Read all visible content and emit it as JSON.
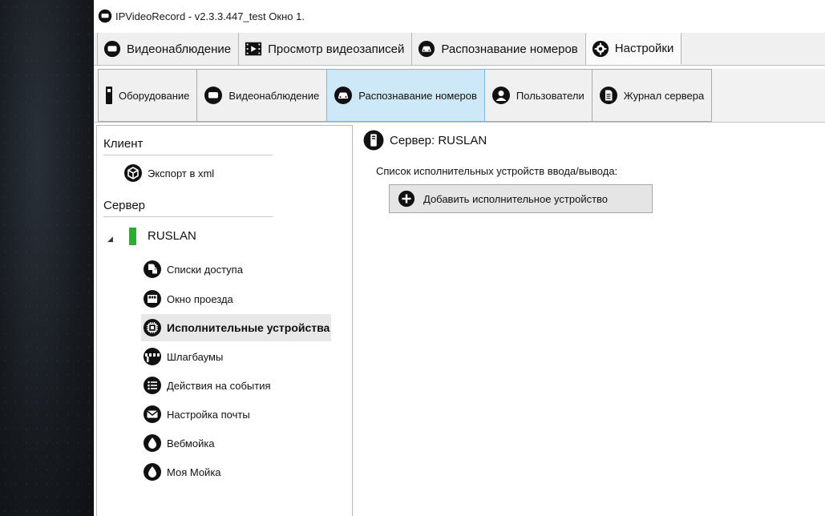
{
  "window": {
    "title": "IPVideoRecord - v2.3.3.447_test Окно 1."
  },
  "main_tabs": [
    {
      "label": "Видеонаблюдение",
      "icon": "monitor-icon"
    },
    {
      "label": "Просмотр видеозаписей",
      "icon": "film-icon"
    },
    {
      "label": "Распознавание номеров",
      "icon": "car-icon"
    },
    {
      "label": "Настройки",
      "icon": "gear-icon",
      "active": true
    }
  ],
  "sub_tabs": [
    {
      "label": "Оборудование",
      "icon": "device-icon"
    },
    {
      "label": "Видеонаблюдение",
      "icon": "monitor-icon"
    },
    {
      "label": "Распознавание номеров",
      "icon": "car-icon",
      "active": true
    },
    {
      "label": "Пользователи",
      "icon": "user-icon"
    },
    {
      "label": "Журнал сервера",
      "icon": "log-icon"
    }
  ],
  "tree": {
    "client_header": "Клиент",
    "client_items": [
      {
        "label": "Экспорт в xml",
        "icon": "cube-icon"
      }
    ],
    "server_header": "Сервер",
    "server_name": "RUSLAN",
    "server_items": [
      {
        "label": "Списки доступа",
        "icon": "access-list-icon"
      },
      {
        "label": "Окно проезда",
        "icon": "window-icon"
      },
      {
        "label": "Исполнительные устройства",
        "icon": "chip-icon",
        "selected": true
      },
      {
        "label": "Шлагбаумы",
        "icon": "barrier-icon"
      },
      {
        "label": "Действия на события",
        "icon": "list-icon"
      },
      {
        "label": "Настройка почты",
        "icon": "mail-icon"
      },
      {
        "label": "Вебмойка",
        "icon": "drop-icon"
      },
      {
        "label": "Моя Мойка",
        "icon": "drop-icon"
      }
    ]
  },
  "content": {
    "server_label": "Сервер: RUSLAN",
    "io_list_label": "Список исполнительных устройств ввода/вывода:",
    "add_button_label": "Добавить исполнительное устройство"
  },
  "colors": {
    "active_subtab": "#cde8f6",
    "server_status": "#27b22d"
  }
}
